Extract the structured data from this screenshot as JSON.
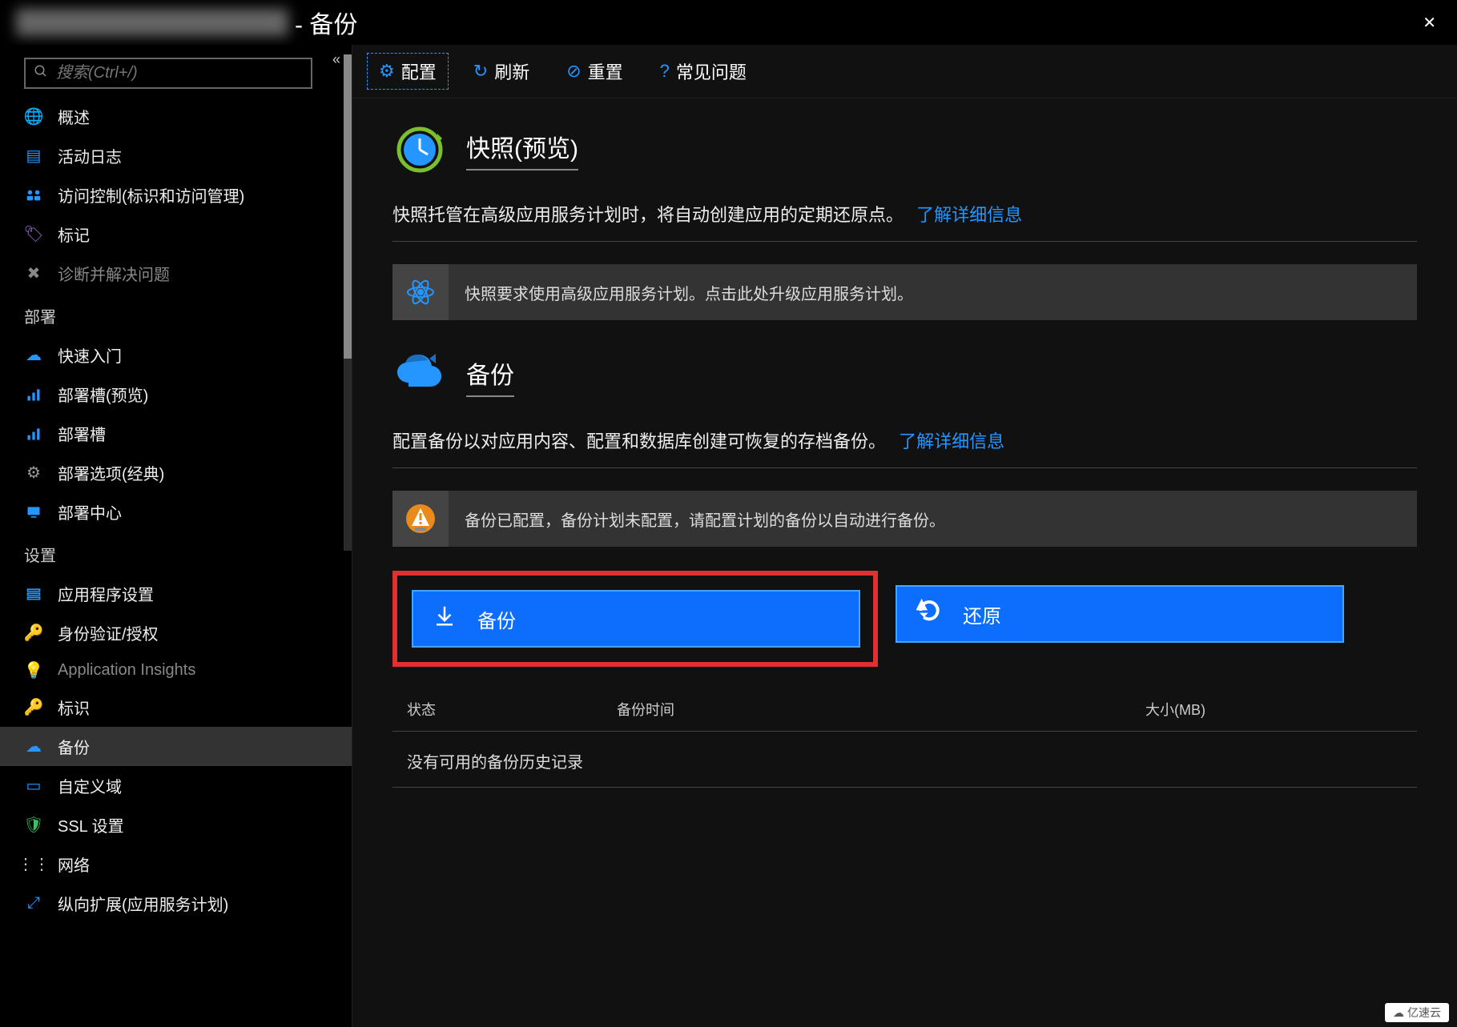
{
  "header": {
    "title_suffix": " - 备份",
    "close_icon": "✕"
  },
  "search": {
    "placeholder": "搜索(Ctrl+/)"
  },
  "nav": {
    "top": [
      {
        "icon": "globe",
        "label": "概述",
        "color": "#2596ff"
      },
      {
        "icon": "log",
        "label": "活动日志",
        "color": "#2596ff"
      },
      {
        "icon": "iam",
        "label": "访问控制(标识和访问管理)",
        "color": "#2596ff"
      },
      {
        "icon": "tag",
        "label": "标记",
        "color": "#a268d6"
      },
      {
        "icon": "wrench",
        "label": "诊断并解决问题",
        "color": "#888",
        "dim": true
      }
    ],
    "deploy_label": "部署",
    "deploy": [
      {
        "icon": "cloud",
        "label": "快速入门",
        "color": "#2596ff"
      },
      {
        "icon": "slots",
        "label": "部署槽(预览)",
        "color": "#2596ff"
      },
      {
        "icon": "slots",
        "label": "部署槽",
        "color": "#2596ff"
      },
      {
        "icon": "gear",
        "label": "部署选项(经典)",
        "color": "#888"
      },
      {
        "icon": "center",
        "label": "部署中心",
        "color": "#2596ff"
      }
    ],
    "settings_label": "设置",
    "settings": [
      {
        "icon": "appset",
        "label": "应用程序设置",
        "color": "#2596ff"
      },
      {
        "icon": "key",
        "label": "身份验证/授权",
        "color": "#f0c040"
      },
      {
        "icon": "bulb",
        "label": "Application Insights",
        "color": "#888",
        "dim": true
      },
      {
        "icon": "key",
        "label": "标识",
        "color": "#f0c040"
      },
      {
        "icon": "cloud-up",
        "label": "备份",
        "color": "#2596ff",
        "selected": true
      },
      {
        "icon": "domain",
        "label": "自定义域",
        "color": "#2596ff"
      },
      {
        "icon": "shield",
        "label": "SSL 设置",
        "color": "#3cc060"
      },
      {
        "icon": "net",
        "label": "网络",
        "color": "#ccc"
      },
      {
        "icon": "scale",
        "label": "纵向扩展(应用服务计划)",
        "color": "#2596ff"
      }
    ]
  },
  "toolbar": {
    "configure": "配置",
    "refresh": "刷新",
    "reset": "重置",
    "faq": "常见问题"
  },
  "snapshot": {
    "title": "快照(预览)",
    "desc": "快照托管在高级应用服务计划时，将自动创建应用的定期还原点。",
    "learn_more": "了解详细信息",
    "info": "快照要求使用高级应用服务计划。点击此处升级应用服务计划。"
  },
  "backup": {
    "title": "备份",
    "desc": "配置备份以对应用内容、配置和数据库创建可恢复的存档备份。",
    "learn_more": "了解详细信息",
    "info": "备份已配置，备份计划未配置，请配置计划的备份以自动进行备份。",
    "backup_btn": "备份",
    "restore_btn": "还原"
  },
  "table": {
    "col_status": "状态",
    "col_time": "备份时间",
    "col_size": "大小(MB)",
    "empty": "没有可用的备份历史记录"
  },
  "watermark": "亿速云"
}
